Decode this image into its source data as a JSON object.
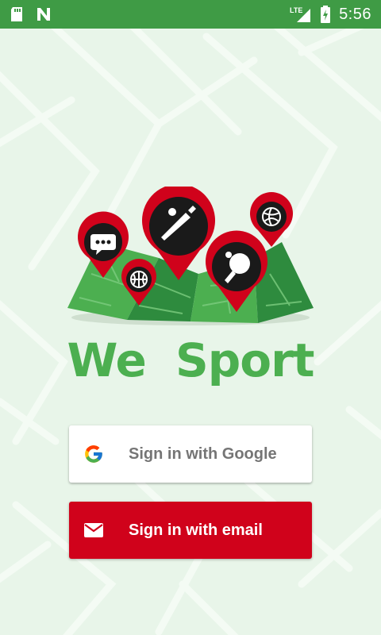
{
  "status_bar": {
    "time": "5:56",
    "network": "LTE",
    "left_icons": [
      "sd-card-icon",
      "n-logo-icon"
    ],
    "right_icons": [
      "signal-icon",
      "battery-icon"
    ]
  },
  "brand": {
    "title": "We Sport",
    "accent_color": "#4caf50",
    "pin_color": "#d0021b",
    "sport_icons": [
      "chat-icon",
      "cricket-icon",
      "volleyball-icon",
      "basketball-icon",
      "table-tennis-icon"
    ]
  },
  "auth": {
    "google_label": "Sign in with Google",
    "email_label": "Sign in with email",
    "google_icon": "google-g-icon",
    "email_icon": "mail-icon"
  },
  "colors": {
    "status_bar": "#3f9b45",
    "background": "#e8f5e9",
    "email_button": "#d0021b"
  }
}
